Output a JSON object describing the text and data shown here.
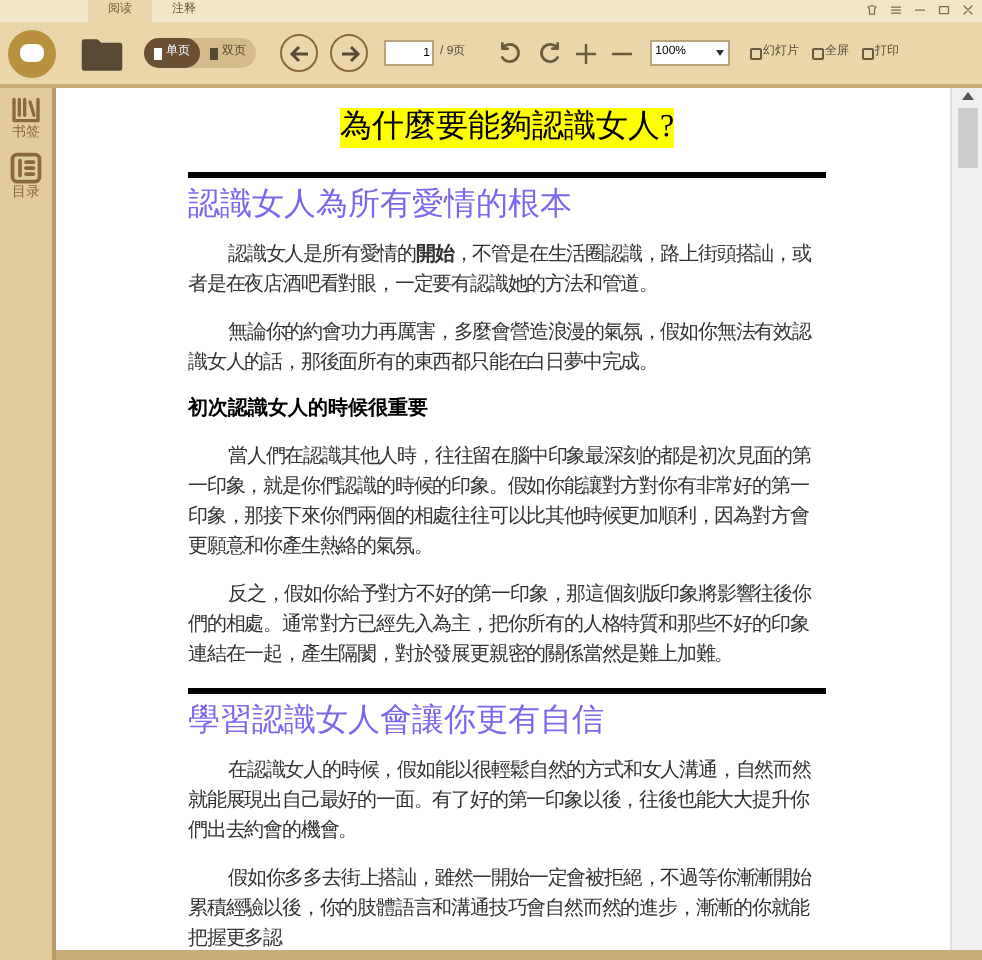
{
  "tabs": [
    {
      "label": "阅读",
      "selected": true
    },
    {
      "label": "注释",
      "selected": false
    }
  ],
  "toolbar": {
    "view_modes": [
      {
        "label": "单页",
        "selected": true
      },
      {
        "label": "双页",
        "selected": false
      }
    ],
    "page_input": "1",
    "page_total": "/ 9页",
    "zoom": "100%",
    "actions": [
      "幻灯片",
      "全屏",
      "打印"
    ]
  },
  "sidebar": {
    "items": [
      {
        "label": "书签",
        "kind": "bookmark"
      },
      {
        "label": "目录",
        "kind": "toc"
      }
    ]
  },
  "document": {
    "blocks": [
      {
        "kind": "title",
        "text": "為什麼要能夠認識女人?"
      },
      {
        "kind": "rule"
      },
      {
        "kind": "heading",
        "text": "認識女人為所有愛情的根本"
      },
      {
        "kind": "paragraph",
        "text": "認識女人是所有愛情的**開始**，不管是在生活圈認識，路上街頭搭訕，或者是在夜店酒吧看對眼，一定要有認識她的方法和管道。"
      },
      {
        "kind": "paragraph",
        "text": "無論你的約會功力再厲害，多麼會營造浪漫的氣氛，假如你無法有效認識女人的話，那後面所有的東西都只能在白日夢中完成。"
      },
      {
        "kind": "subheading",
        "text": "初次認識女人的時候很重要"
      },
      {
        "kind": "paragraph",
        "text": "當人們在認識其他人時，往往留在腦中印象最深刻的都是初次見面的第一印象，就是你們認識的時候的印象。假如你能讓對方對你有非常好的第一印象，那接下來你們兩個的相處往往可以比其他時候更加順利，因為對方會更願意和你產生熱絡的氣氛。"
      },
      {
        "kind": "paragraph",
        "text": "反之，假如你給予對方不好的第一印象，那這個刻版印象將影響往後你們的相處。通常對方已經先入為主，把你所有的人格特質和那些不好的印象連結在一起，產生隔閡，對於發展更親密的關係當然是難上加難。"
      },
      {
        "kind": "rule"
      },
      {
        "kind": "heading",
        "text": "學習認識女人會讓你更有自信"
      },
      {
        "kind": "paragraph",
        "text": "在認識女人的時候，假如能以很輕鬆自然的方式和女人溝通，自然而然就能展現出自己最好的一面。有了好的第一印象以後，往後也能大大提升你們出去約會的機會。"
      },
      {
        "kind": "paragraph",
        "text": "假如你多多去街上搭訕，雖然一開始一定會被拒絕，不過等你漸漸開始累積經驗以後，你的肢體語言和溝通技巧會自然而然的進步，漸漸的你就能把握更多認"
      }
    ]
  }
}
